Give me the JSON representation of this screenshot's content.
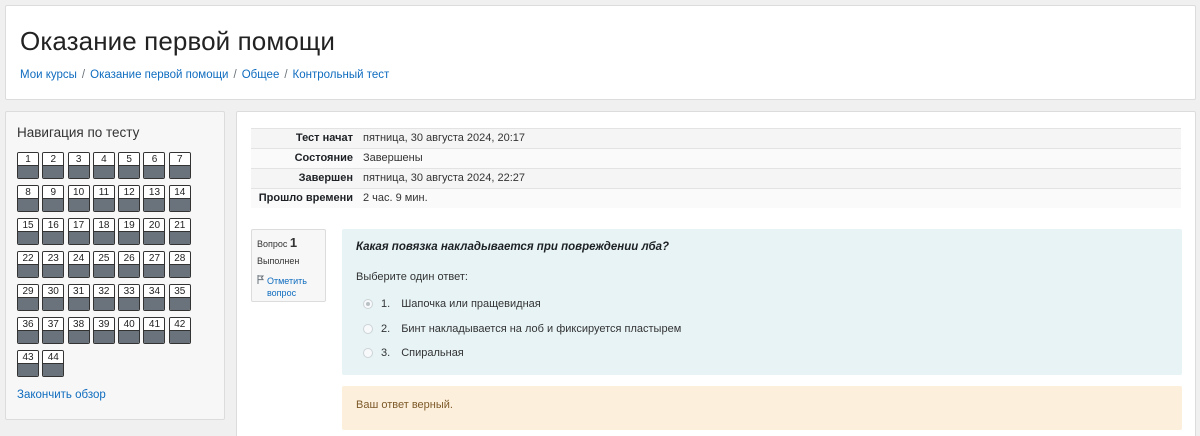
{
  "header": {
    "title": "Оказание первой помощи",
    "breadcrumb": [
      "Мои курсы",
      "Оказание первой помощи",
      "Общее",
      "Контрольный тест"
    ]
  },
  "quiz_nav": {
    "title": "Навигация по тесту",
    "questions": [
      "1",
      "2",
      "3",
      "4",
      "5",
      "6",
      "7",
      "8",
      "9",
      "10",
      "11",
      "12",
      "13",
      "14",
      "15",
      "16",
      "17",
      "18",
      "19",
      "20",
      "21",
      "22",
      "23",
      "24",
      "25",
      "26",
      "27",
      "28",
      "29",
      "30",
      "31",
      "32",
      "33",
      "34",
      "35",
      "36",
      "37",
      "38",
      "39",
      "40",
      "41",
      "42",
      "43",
      "44"
    ],
    "finish_label": "Закончить обзор"
  },
  "summary": {
    "rows": [
      {
        "label": "Тест начат",
        "value": "пятница, 30 августа 2024, 20:17"
      },
      {
        "label": "Состояние",
        "value": "Завершены"
      },
      {
        "label": "Завершен",
        "value": "пятница, 30 августа 2024, 22:27"
      },
      {
        "label": "Прошло времени",
        "value": "2 час. 9 мин."
      }
    ]
  },
  "question": {
    "number_label": "Вопрос",
    "number": "1",
    "state": "Выполнен",
    "flag_label": "Отметить вопрос",
    "text": "Какая повязка накладывается при повреждении лба?",
    "prompt": "Выберите один ответ:",
    "answers": [
      {
        "letter": "1.",
        "text": "Шапочка или пращевидная",
        "selected": true
      },
      {
        "letter": "2.",
        "text": "Бинт накладывается на лоб и фиксируется пластырем",
        "selected": false
      },
      {
        "letter": "3.",
        "text": "Спиральная",
        "selected": false
      }
    ],
    "feedback": "Ваш ответ верный."
  },
  "colors": {
    "link": "#0f6cbf",
    "formulation_bg": "#e7f3f5",
    "feedback_bg": "#fcefdc",
    "nav_state": "#6a737b"
  }
}
